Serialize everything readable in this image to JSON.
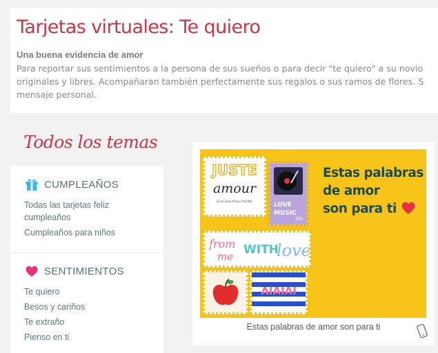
{
  "header": {
    "title": "Tarjetas virtuales: Te quiero",
    "subtitle": "Una buena evidencia de amor",
    "paragraph_lines": [
      "Para reportar sus sentimientos a la persona de sus sueños o para decir \"te quiero\" a su novio",
      "originales y libres. Acompañaran también perfectamente sus regalos o sus ramos de flores. S",
      "mensaje personal."
    ]
  },
  "sidebar": {
    "title": "Todos los temas",
    "sections": [
      {
        "icon": "gift-icon",
        "label": "CUMPLEAÑOS",
        "links": [
          "Todas las tarjetas feliz cumpleaños",
          "Cumpleaños para niños"
        ]
      },
      {
        "icon": "heart-icon",
        "label": "SENTIMIENTOS",
        "links": [
          "Te quiero",
          "Besos y cariños",
          "Te extraño",
          "Pienso en ti"
        ]
      }
    ]
  },
  "card": {
    "image_text_lines": [
      "Estas palabras",
      "de amor",
      "son para ti"
    ],
    "stamp_texts": [
      "JUSTE",
      "amour",
      "& un peu d'eau fraîche",
      "LOVE",
      "MUSIC",
      "295",
      "from",
      "me",
      "WITH",
      "love",
      "AIAIAI"
    ],
    "caption": "Estas palabras de amor son para ti",
    "colors": {
      "background": "#f8c41a",
      "text": "#1d4b49",
      "heart": "#e8313f"
    },
    "device_icon": "phone-icon"
  },
  "colors": {
    "accent": "#c8364b",
    "link": "#5f7882",
    "section_label": "#5b6e78",
    "gift": "#3cb6e0",
    "heart": "#e8337a"
  }
}
